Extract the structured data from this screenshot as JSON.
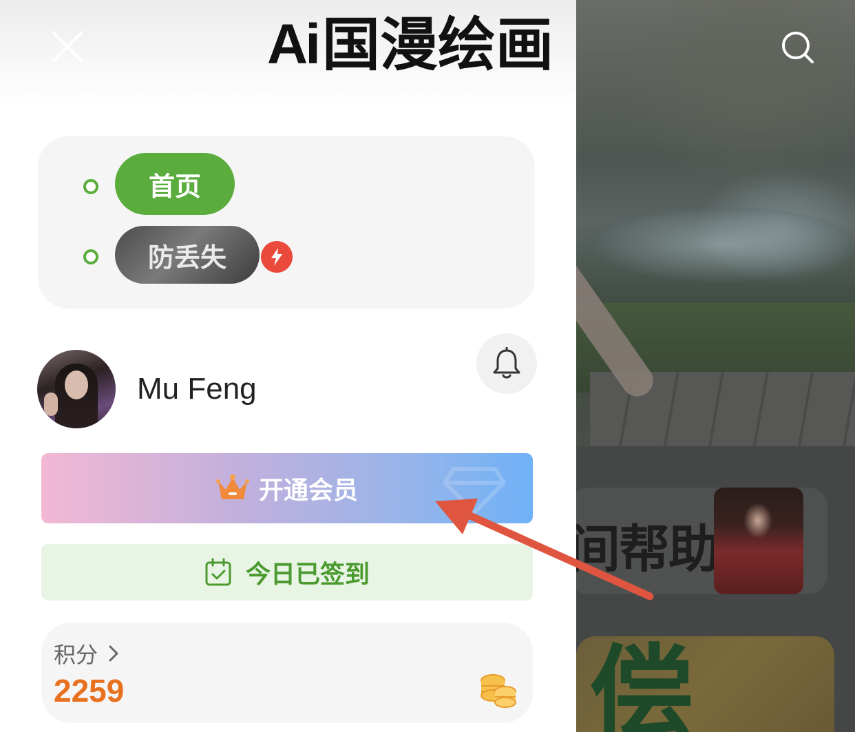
{
  "header": {
    "logo_ai": "Ai",
    "logo_text": "国漫绘画"
  },
  "nav": {
    "items": [
      {
        "label": "首页",
        "active": true
      },
      {
        "label": "防丢失",
        "active": false
      }
    ]
  },
  "user": {
    "name": "Mu Feng"
  },
  "buttons": {
    "vip_label": "开通会员",
    "checkin_label": "今日已签到"
  },
  "points": {
    "title": "积分",
    "value": "2259"
  },
  "background": {
    "help_text": "间帮助",
    "yellow_char": "偿"
  },
  "colors": {
    "green_accent": "#5aad3d",
    "points_orange": "#e8711f",
    "annotation_arrow": "#e0553f"
  },
  "icons": [
    "close-icon",
    "search-icon",
    "bell-icon",
    "crown-icon",
    "calendar-check-icon",
    "bolt-icon",
    "coins-icon",
    "chevron-right-icon"
  ]
}
